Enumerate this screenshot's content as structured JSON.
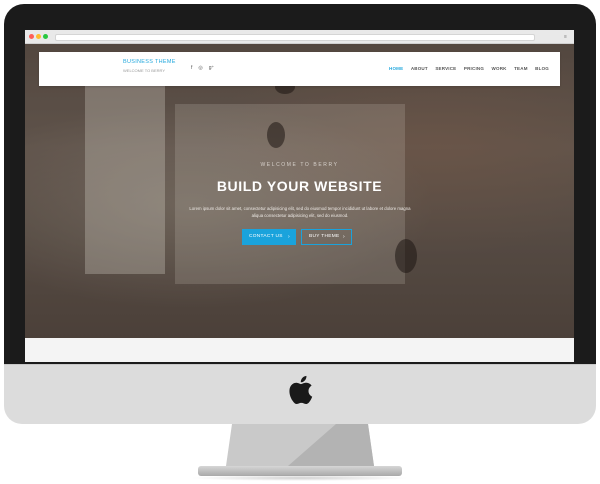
{
  "site": {
    "brand_name": "BUSINESS THEME",
    "brand_tagline": "WELCOME TO BERRY",
    "social_icons": [
      "facebook-icon",
      "dribbble-icon",
      "google-plus-icon"
    ],
    "social_glyphs": [
      "f",
      "◎",
      "g⁺"
    ],
    "menu": [
      {
        "label": "HOME",
        "active": true
      },
      {
        "label": "ABOUT"
      },
      {
        "label": "SERVICE"
      },
      {
        "label": "PRICING"
      },
      {
        "label": "WORK"
      },
      {
        "label": "TEAM"
      },
      {
        "label": "BLOG"
      }
    ]
  },
  "hero": {
    "welcome": "WELCOME TO BERRY",
    "headline": "BUILD YOUR WEBSITE",
    "lead": "Lorem ipsum dolor sit amet, consectetur adipisicing elit, sed do eiusmod tempor incididunt ut labore et dolore magna aliqua consectetur adipisicing elit, sed do eiusmod.",
    "primary_button": "CONTACT US",
    "secondary_button": "BUY THEME",
    "arrow": "›"
  },
  "colors": {
    "accent": "#1aa3dc",
    "bezel": "#1b1b1b",
    "chin": "#dcdcdc"
  }
}
